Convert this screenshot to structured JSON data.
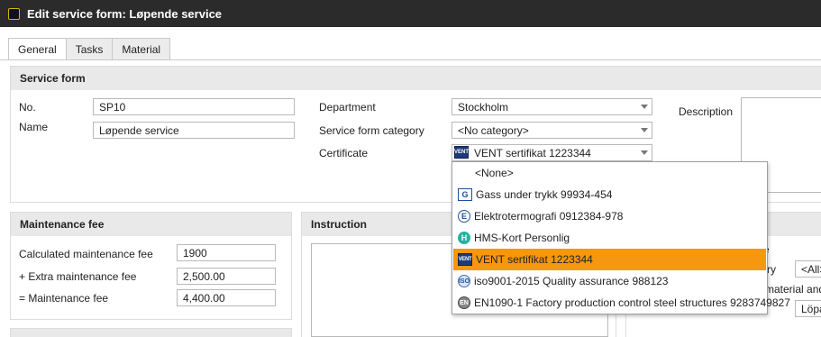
{
  "window": {
    "title": "Edit service form: Løpende service"
  },
  "tabs": [
    {
      "label": "General"
    },
    {
      "label": "Tasks"
    },
    {
      "label": "Material"
    }
  ],
  "service_form": {
    "header": "Service form",
    "no_label": "No.",
    "no_value": "SP10",
    "name_label": "Name",
    "name_value": "Løpende service",
    "department_label": "Department",
    "department_value": "Stockholm",
    "category_label": "Service form category",
    "category_value": "<No category>",
    "certificate_label": "Certificate",
    "certificate_value": "VENT sertifikat 1223344",
    "description_label": "Description"
  },
  "certificate_dropdown": {
    "items": [
      {
        "label": "<None>",
        "icon": "none"
      },
      {
        "label": "Gass under trykk 99934-454",
        "icon": "gas-certificate-icon"
      },
      {
        "label": "Elektrotermografi 0912384-978",
        "icon": "elektro-certificate-icon"
      },
      {
        "label": "HMS-Kort Personlig",
        "icon": "hms-certificate-icon"
      },
      {
        "label": "VENT sertifikat 1223344",
        "icon": "vent-certificate-icon",
        "selected": true
      },
      {
        "label": "iso9001-2015 Quality assurance 988123",
        "icon": "iso-certificate-icon"
      },
      {
        "label": "EN1090-1 Factory production control steel structures 9283749827",
        "icon": "en-certificate-icon"
      }
    ],
    "selected_color": "#f5970f"
  },
  "maintenance_fee": {
    "header": "Maintenance fee",
    "calculated_label": "Calculated maintenance fee",
    "calculated_value": "1900",
    "extra_label": "+ Extra maintenance fee",
    "extra_value": "2,500.00",
    "total_label": "= Maintenance fee",
    "total_value": "4,400.00"
  },
  "instruction": {
    "header": "Instruction"
  },
  "right_panel": {
    "partial_label_e": "e",
    "partial_label_ry": "ry",
    "partial_label_material": "material and i",
    "all_value": "<All>",
    "lopa_value": "Löpa"
  }
}
